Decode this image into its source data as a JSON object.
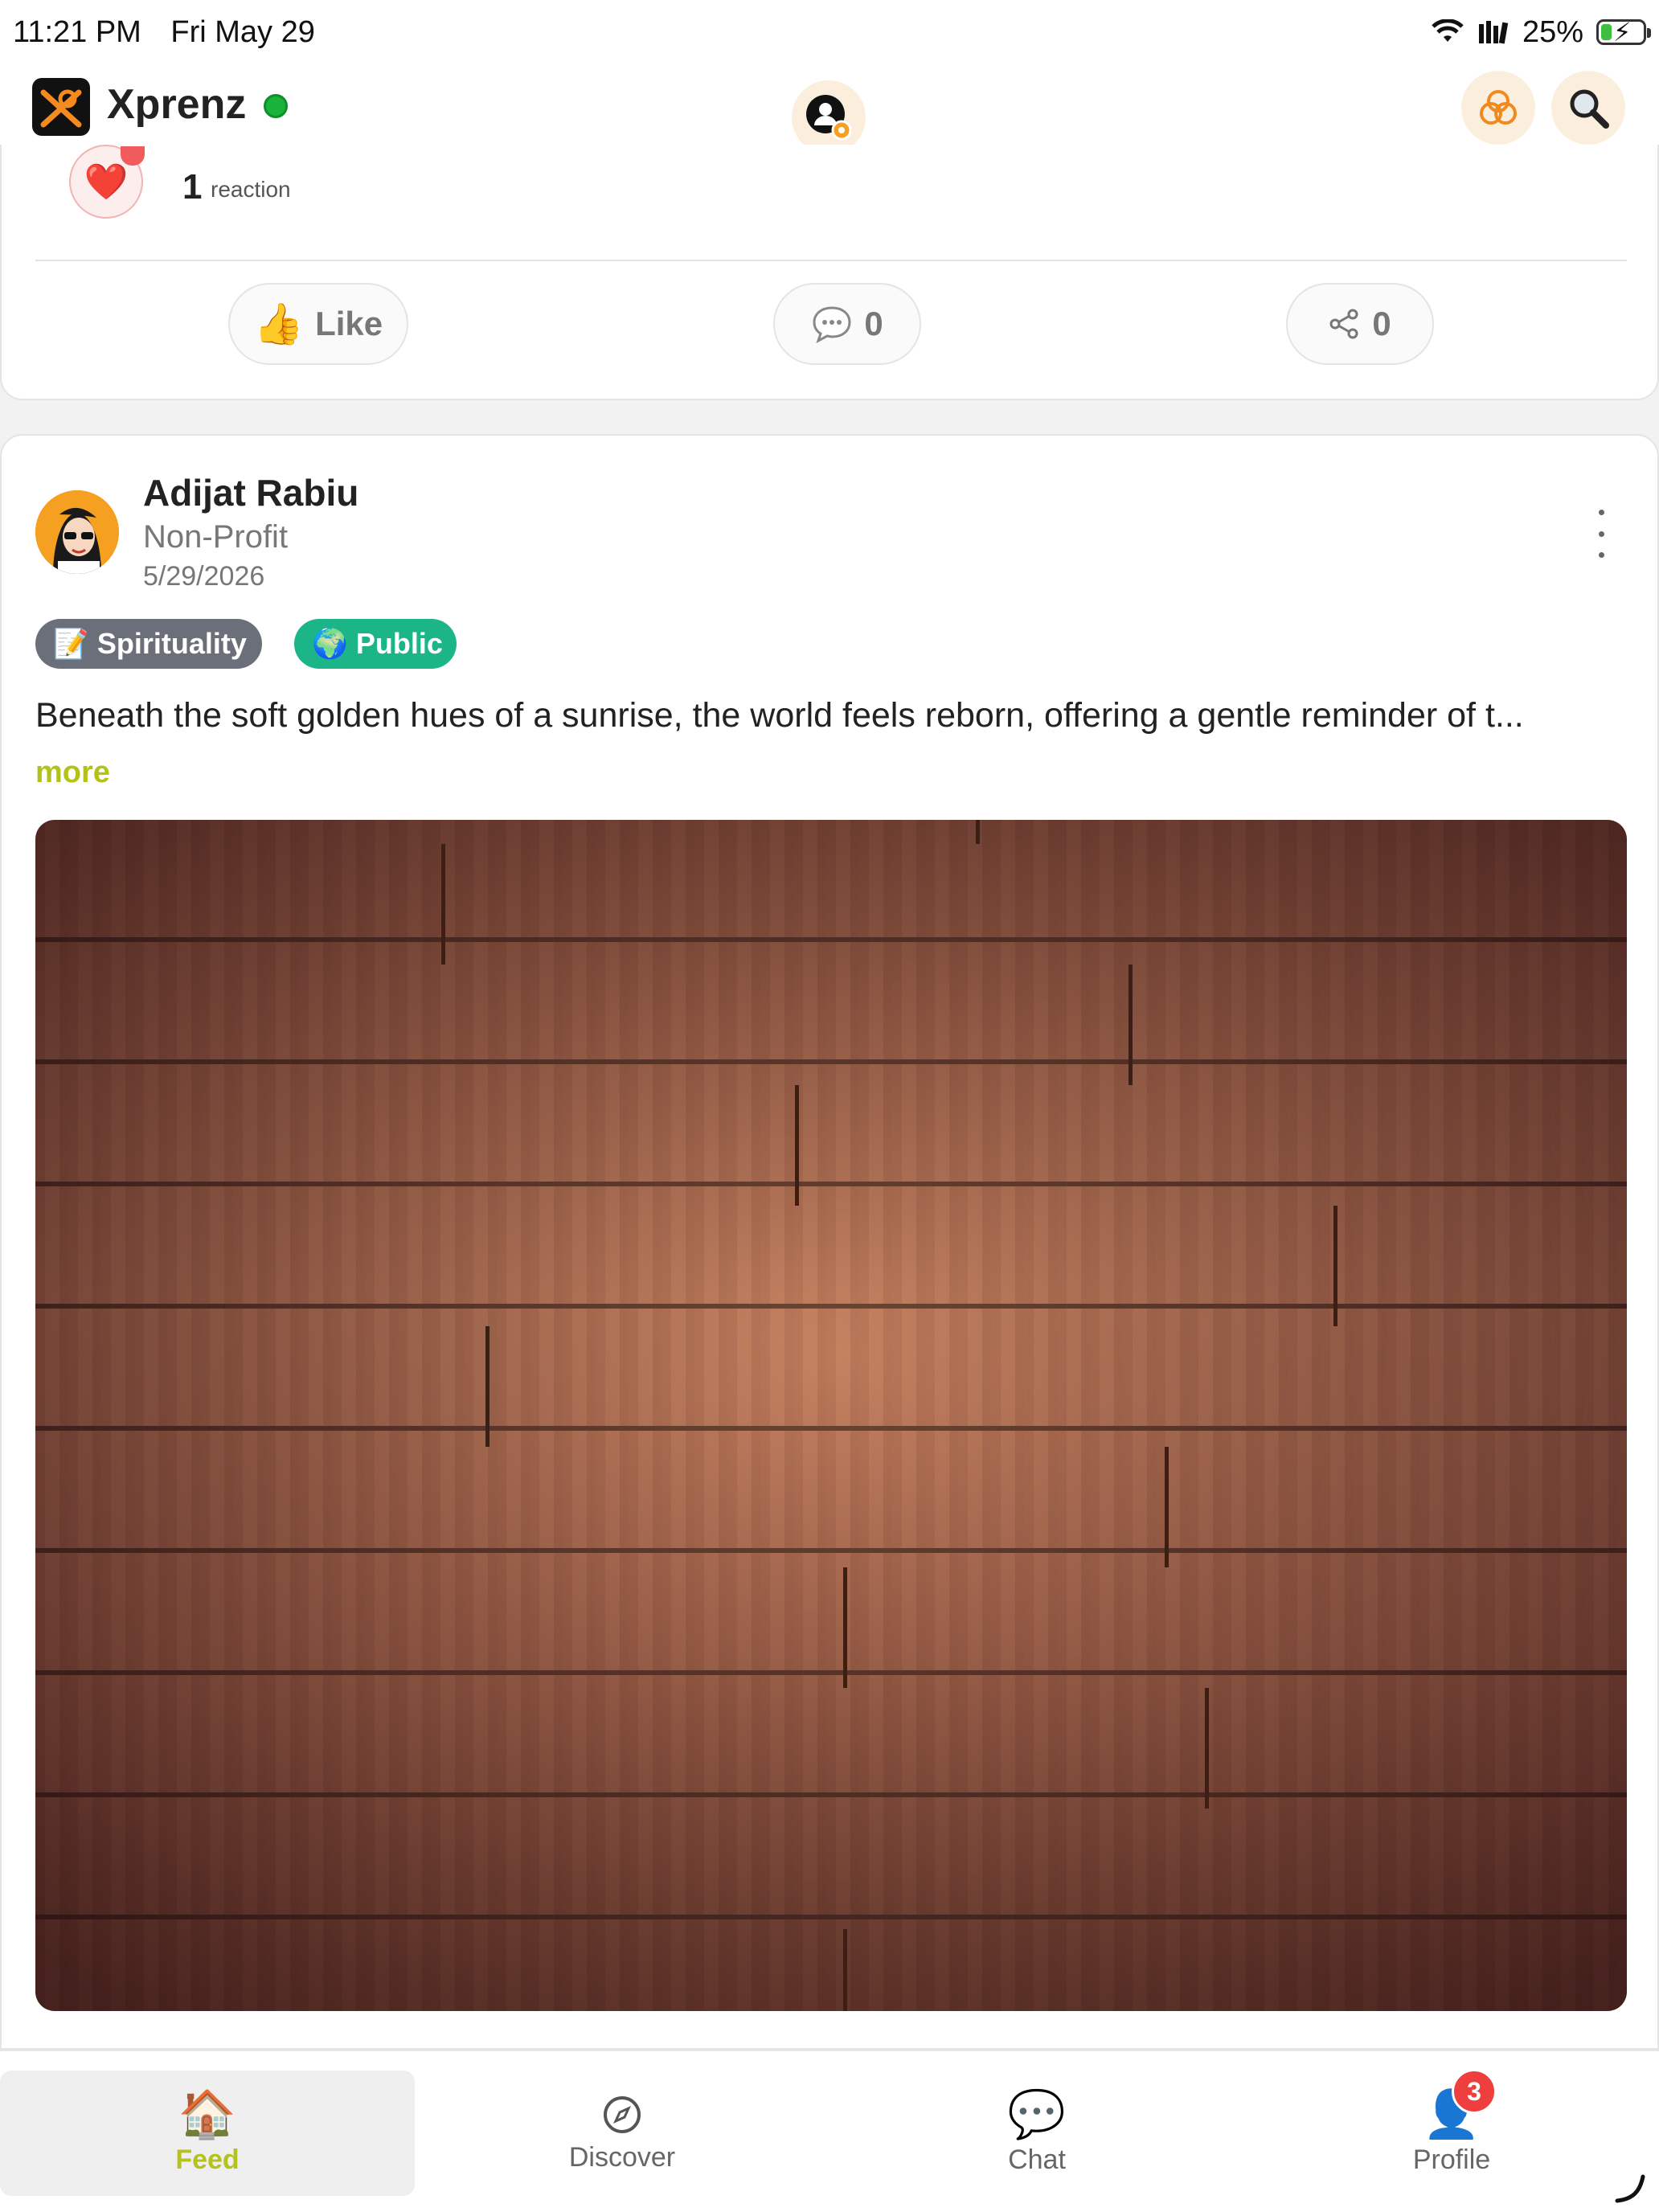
{
  "status_bar": {
    "time": "11:21 PM",
    "date": "Fri May 29",
    "battery": "25%",
    "battery_level": 0.25
  },
  "header": {
    "app_name": "Xprenz",
    "online_color": "#19b33b"
  },
  "previous_post": {
    "reaction_emoji": "❤️",
    "reaction_count": "1",
    "reaction_label": "reaction",
    "like_label": "Like",
    "like_emoji": "👍",
    "comment_count": "0",
    "share_count": "0"
  },
  "post": {
    "author": "Adijat Rabiu",
    "role": "Non-Profit",
    "date": "5/29/2026",
    "tags": [
      {
        "emoji": "📝",
        "label": "Spirituality",
        "color": "#6b6f7a"
      },
      {
        "emoji": "🌍",
        "label": "Public",
        "color": "#1cb588"
      }
    ],
    "text": "Beneath the soft golden hues of a sunrise, the world feels reborn, offering a gentle reminder of t...",
    "more_label": "more"
  },
  "tabbar": {
    "items": [
      {
        "label": "Feed",
        "icon": "house-icon",
        "glyph": "🏠"
      },
      {
        "label": "Discover",
        "icon": "compass-icon",
        "glyph": ""
      },
      {
        "label": "Chat",
        "icon": "chat-bubble-icon",
        "glyph": "💬"
      },
      {
        "label": "Profile",
        "icon": "person-icon",
        "glyph": "👤"
      }
    ],
    "profile_badge": "3",
    "accent_color": "#b5c21c"
  }
}
